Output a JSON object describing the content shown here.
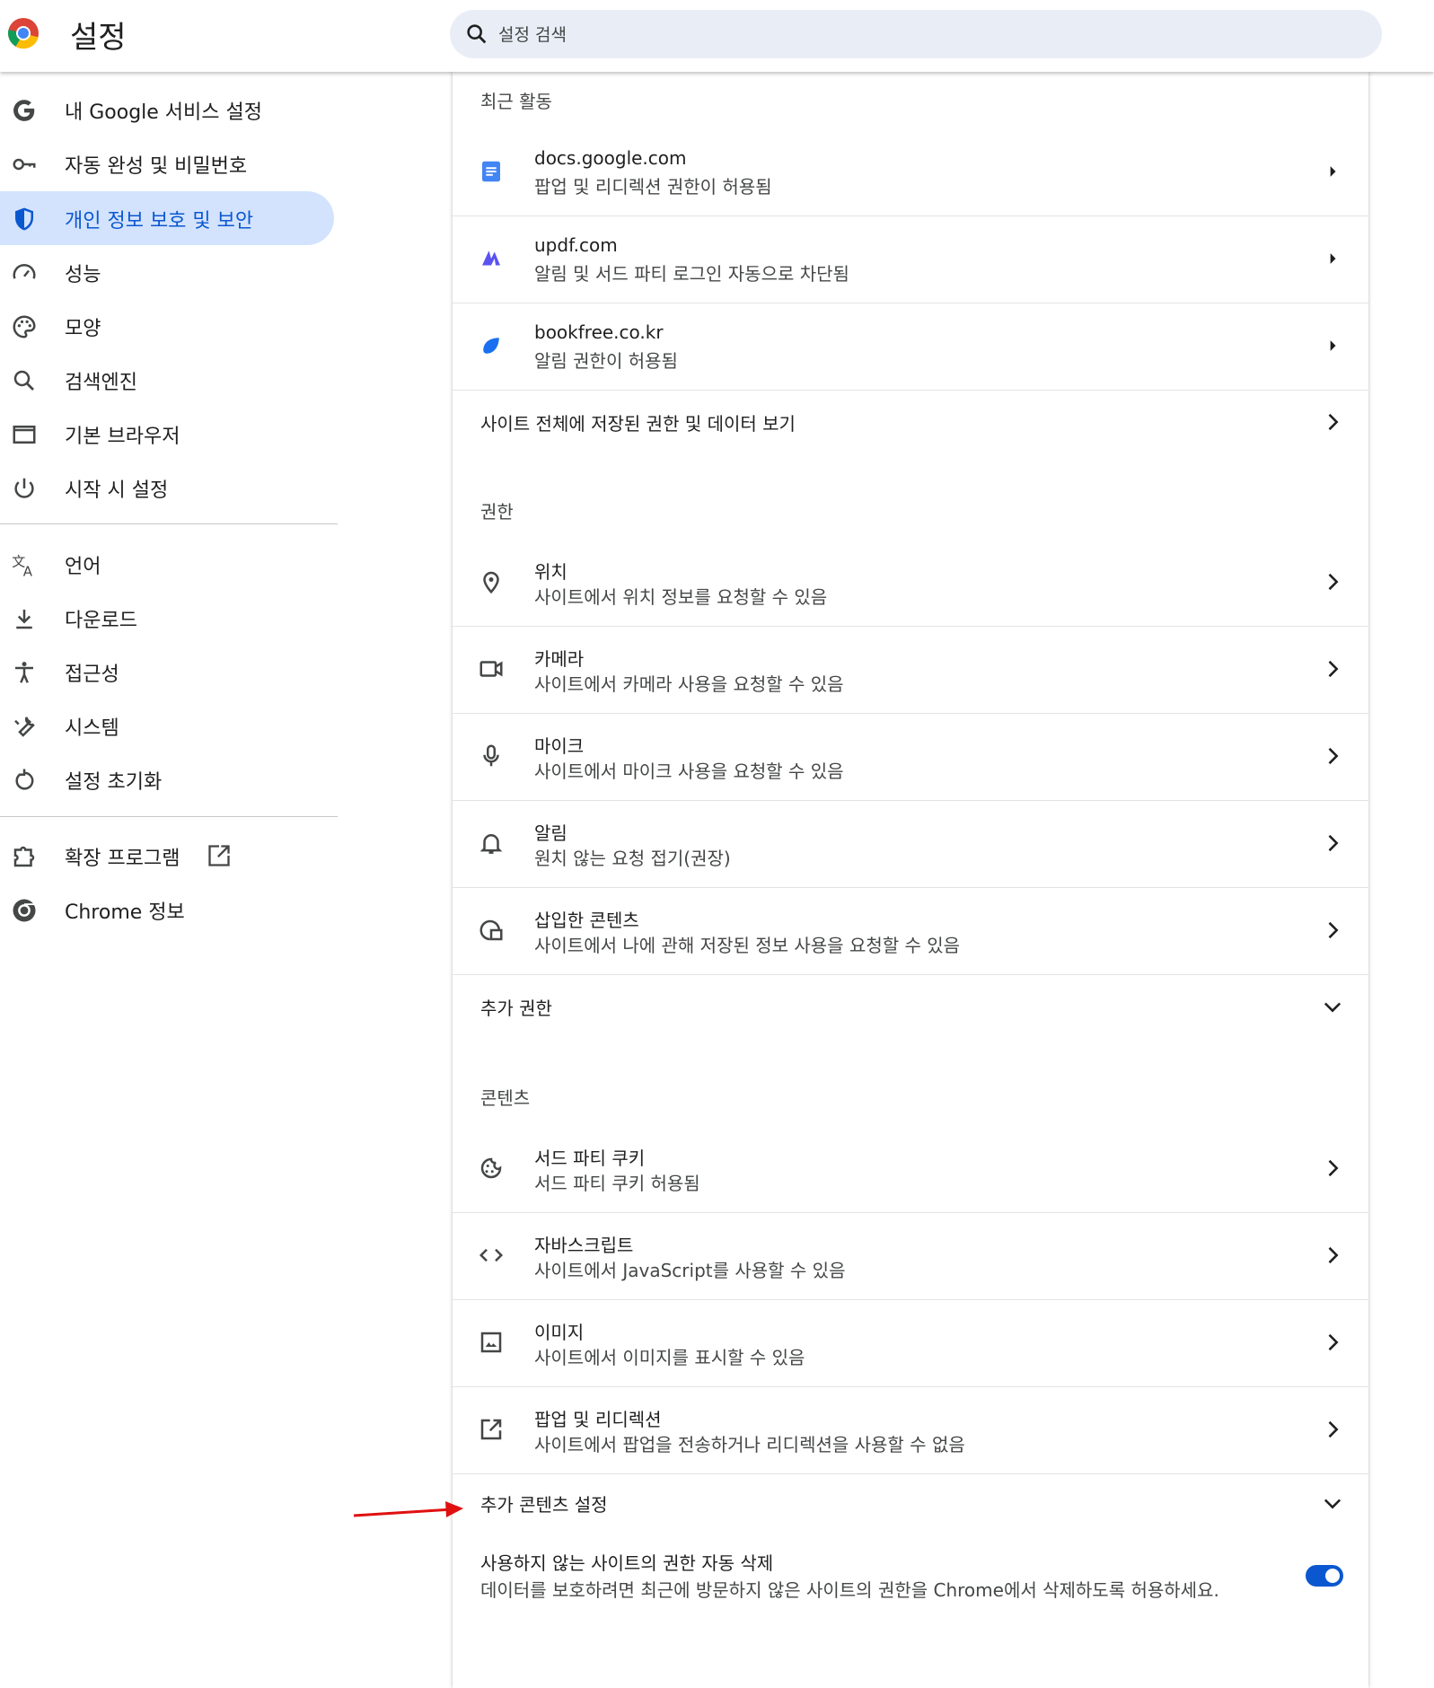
{
  "header": {
    "title": "설정",
    "search_placeholder": "설정 검색",
    "logo_icon": "chrome-logo-icon"
  },
  "sidebar": {
    "items": [
      {
        "label": "내 Google 서비스 설정",
        "icon": "google-g-icon"
      },
      {
        "label": "자동 완성 및 비밀번호",
        "icon": "key-icon"
      },
      {
        "label": "개인 정보 보호 및 보안",
        "icon": "shield-icon",
        "active": true
      },
      {
        "label": "성능",
        "icon": "speedometer-icon"
      },
      {
        "label": "모양",
        "icon": "palette-icon"
      },
      {
        "label": "검색엔진",
        "icon": "search-icon"
      },
      {
        "label": "기본 브라우저",
        "icon": "browser-window-icon"
      },
      {
        "label": "시작 시 설정",
        "icon": "power-icon"
      },
      {
        "label": "언어",
        "icon": "translate-icon"
      },
      {
        "label": "다운로드",
        "icon": "download-icon"
      },
      {
        "label": "접근성",
        "icon": "accessibility-icon"
      },
      {
        "label": "시스템",
        "icon": "wrench-icon"
      },
      {
        "label": "설정 초기화",
        "icon": "reset-icon"
      },
      {
        "label": "확장 프로그램",
        "icon": "puzzle-icon",
        "external_icon": "open-in-new-icon"
      },
      {
        "label": "Chrome 정보",
        "icon": "chrome-icon"
      }
    ]
  },
  "recent": {
    "heading": "최근 활동",
    "items": [
      {
        "title": "docs.google.com",
        "subtitle": "팝업 및 리디렉션 권한이 허용됨",
        "icon": "docs-icon"
      },
      {
        "title": "updf.com",
        "subtitle": "알림 및 서드 파티 로그인 자동으로 차단됨",
        "icon": "updf-icon"
      },
      {
        "title": "bookfree.co.kr",
        "subtitle": "알림 권한이 허용됨",
        "icon": "bookfree-icon"
      }
    ],
    "all_sites_label": "사이트 전체에 저장된 권한 및 데이터 보기"
  },
  "permissions": {
    "heading": "권한",
    "items": [
      {
        "title": "위치",
        "subtitle": "사이트에서 위치 정보를 요청할 수 있음",
        "icon": "location-pin-icon"
      },
      {
        "title": "카메라",
        "subtitle": "사이트에서 카메라 사용을 요청할 수 있음",
        "icon": "camera-icon"
      },
      {
        "title": "마이크",
        "subtitle": "사이트에서 마이크 사용을 요청할 수 있음",
        "icon": "mic-icon"
      },
      {
        "title": "알림",
        "subtitle": "원치 않는 요청 접기(권장)",
        "icon": "bell-icon"
      },
      {
        "title": "삽입한 콘텐츠",
        "subtitle": "사이트에서 나에 관해 저장된 정보 사용을 요청할 수 있음",
        "icon": "embedded-content-icon"
      }
    ],
    "more_label": "추가 권한"
  },
  "content": {
    "heading": "콘텐츠",
    "items": [
      {
        "title": "서드 파티 쿠키",
        "subtitle": "서드 파티 쿠키 허용됨",
        "icon": "cookie-icon"
      },
      {
        "title": "자바스크립트",
        "subtitle": "사이트에서 JavaScript를 사용할 수 있음",
        "icon": "code-icon"
      },
      {
        "title": "이미지",
        "subtitle": "사이트에서 이미지를 표시할 수 있음",
        "icon": "image-icon"
      },
      {
        "title": "팝업 및 리디렉션",
        "subtitle": "사이트에서 팝업을 전송하거나 리디렉션을 사용할 수 없음",
        "icon": "open-in-new-icon"
      }
    ],
    "more_label": "추가 콘텐츠 설정"
  },
  "auto_remove": {
    "title": "사용하지 않는 사이트의 권한 자동 삭제",
    "subtitle": "데이터를 보호하려면 최근에 방문하지 않은 사이트의 권한을 Chrome에서 삭제하도록 허용하세요.",
    "enabled": true
  },
  "colors": {
    "accent": "#0b57d0",
    "active_nav_bg": "#d3e3fd",
    "search_bg": "#e9eef6",
    "annotation_arrow": "#e01010"
  }
}
